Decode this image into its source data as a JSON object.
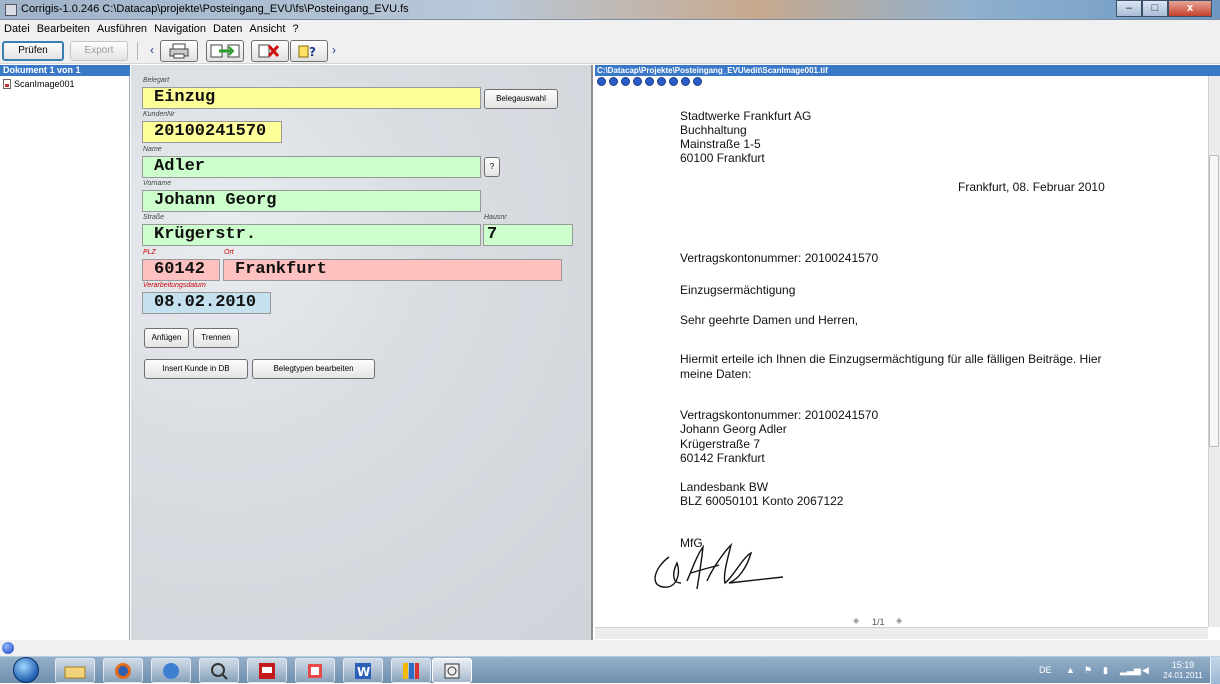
{
  "window": {
    "title": "Corrigis-1.0.246  C:\\Datacap\\projekte\\Posteingang_EVU\\fs\\Posteingang_EVU.fs",
    "minimize": "–",
    "maximize": "□",
    "close": "x"
  },
  "menu": [
    "Datei",
    "Bearbeiten",
    "Ausführen",
    "Navigation",
    "Daten",
    "Ansicht",
    "?"
  ],
  "toolbar": {
    "pruefen": "Prüfen",
    "export": "Export",
    "prev": "‹",
    "next": "›"
  },
  "left_panel": {
    "header": "Dokument 1 von 1",
    "items": [
      "ScanImage001"
    ]
  },
  "form": {
    "belegart": {
      "label": "Belegart",
      "value": "Einzug"
    },
    "belegauswahl_button": "Belegauswahl",
    "kundennr": {
      "label": "KundenNr",
      "value": "20100241570"
    },
    "name": {
      "label": "Name",
      "value": "Adler"
    },
    "help_button": "?",
    "vorname": {
      "label": "Vorname",
      "value": "Johann Georg"
    },
    "strasse": {
      "label": "Straße",
      "value": "Krügerstr."
    },
    "hausnr": {
      "label": "Hausnr",
      "value": "7"
    },
    "plz": {
      "label": "PLZ",
      "value": "60142"
    },
    "ort": {
      "label": "Ort",
      "value": "Frankfurt"
    },
    "datum": {
      "label": "Verarbeitungsdatum",
      "value": "08.02.2010"
    },
    "anfuegen_button": "Anfügen",
    "trennen_button": "Trennen",
    "insert_button": "Insert Kunde in DB",
    "belegtypen_button": "Belegtypen bearbeiten"
  },
  "viewer": {
    "path": "C:\\Datacap\\Projekte\\Posteingang_EVU\\edit\\ScanImage001.tif",
    "sender": [
      "Stadtwerke Frankfurt AG",
      "Buchhaltung",
      "Mainstraße 1-5",
      "60100 Frankfurt"
    ],
    "date_line": "Frankfurt, 08. Februar 2010",
    "contract_line": "Vertragskontonummer: 20100241570",
    "subject": "Einzugsermächtigung",
    "salutation": "Sehr geehrte Damen und Herren,",
    "body": [
      "Hiermit erteile ich Ihnen die Einzugsermächtigung für alle fälligen Beiträge. Hier",
      "meine Daten:"
    ],
    "data_block": [
      "Vertragskontonummer: 20100241570",
      "Johann Georg Adler",
      "Krügerstraße 7",
      "60142 Frankfurt"
    ],
    "bank_block": [
      "Landesbank BW",
      "BLZ 60050101 Konto 2067122"
    ],
    "closing": "MfG",
    "page": "1/1"
  },
  "taskbar": {
    "lang": "DE",
    "time": "15:19",
    "date": "24.01.2011",
    "apps": [
      "explorer-icon",
      "firefox-icon",
      "network-icon",
      "search-icon",
      "pdf-icon",
      "paint-icon",
      "word-icon",
      "media-icon",
      "corrigis-icon"
    ]
  },
  "colors": {
    "field_yellow": "#ffff99",
    "field_green": "#ccffcc",
    "field_pink": "#ffc0c0",
    "field_blue": "#c5e0ef",
    "panel_header": "#3a78c8",
    "label_red": "#cc0000"
  }
}
